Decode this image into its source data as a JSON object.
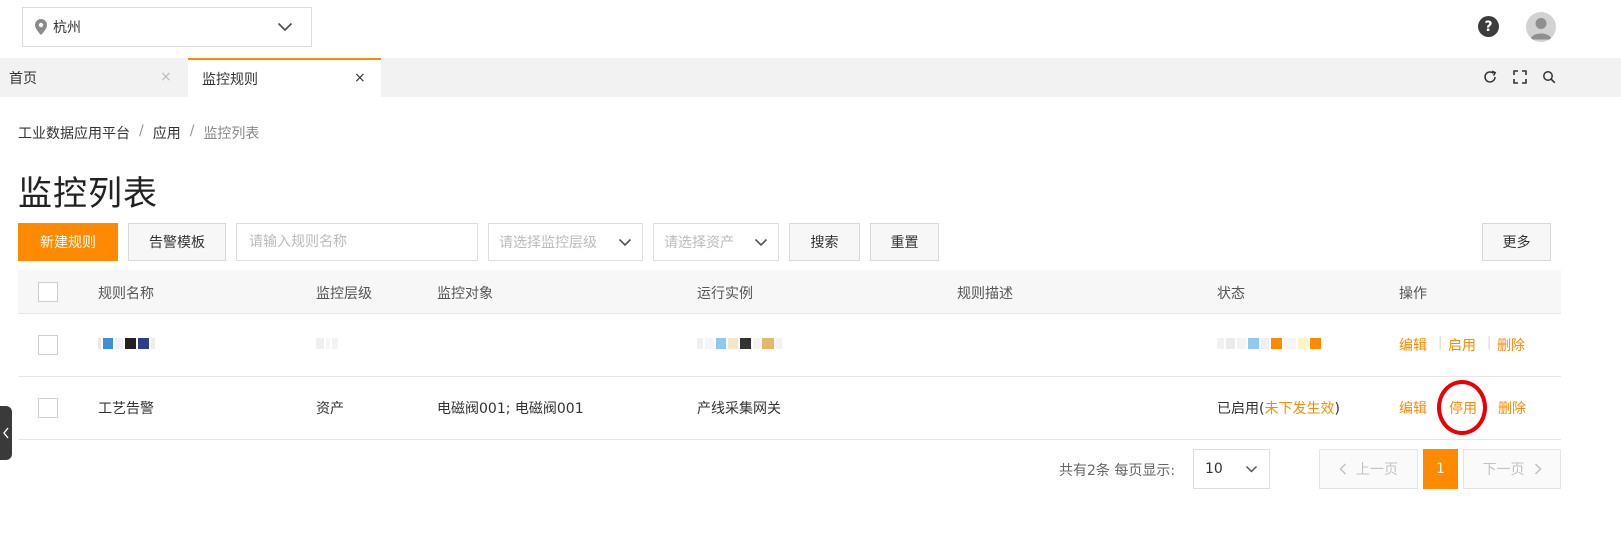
{
  "header": {
    "region": {
      "value": "杭州",
      "pin_icon": "location-pin-icon",
      "arrow_icon": "chevron-down-icon"
    },
    "help_icon": "question-circle-icon",
    "help_glyph": "?",
    "avatar_icon": "user-avatar-icon"
  },
  "tabs": [
    {
      "label": "首页",
      "active": false,
      "close": "×"
    },
    {
      "label": "监控规则",
      "active": true,
      "close": "×"
    }
  ],
  "tab_tools": [
    "refresh-icon",
    "fullscreen-icon",
    "search-icon"
  ],
  "breadcrumb": {
    "items": [
      "工业数据应用平台",
      "应用",
      "监控列表"
    ],
    "separator": "/"
  },
  "page_title": "监控列表",
  "toolbar": {
    "new_rule_label": "新建规则",
    "alert_template_label": "告警模板",
    "rule_name_placeholder": "请输入规则名称",
    "monitor_level_placeholder": "请选择监控层级",
    "asset_placeholder": "请选择资产",
    "search_label": "搜索",
    "reset_label": "重置",
    "more_label": "更多"
  },
  "table": {
    "columns": [
      "规则名称",
      "监控层级",
      "监控对象",
      "运行实例",
      "规则描述",
      "状态",
      "操作"
    ],
    "rows": [
      {
        "name": "",
        "level": "",
        "target": "",
        "instance": "",
        "description": "",
        "status": "",
        "actions": [
          "编辑",
          "启用",
          "删除"
        ],
        "redacted": true
      },
      {
        "name": "工艺告警",
        "level": "资产",
        "target": "电磁阀001; 电磁阀001",
        "instance": "产线采集网关",
        "description": "",
        "status_prefix": "已启用(",
        "status_link": "未下发生效",
        "status_suffix": ")",
        "actions": [
          "编辑",
          "停用",
          "删除"
        ],
        "redacted": false
      }
    ],
    "action_separator": "|"
  },
  "pagination": {
    "summary": "共有2条 每页显示:",
    "page_size": "10",
    "prev_label": "上一页",
    "next_label": "下一页",
    "current_page": "1"
  },
  "colors": {
    "accent": "#ff8a00",
    "highlight_ring": "#ee0000",
    "tabbar_bg": "#f2f2f2"
  }
}
